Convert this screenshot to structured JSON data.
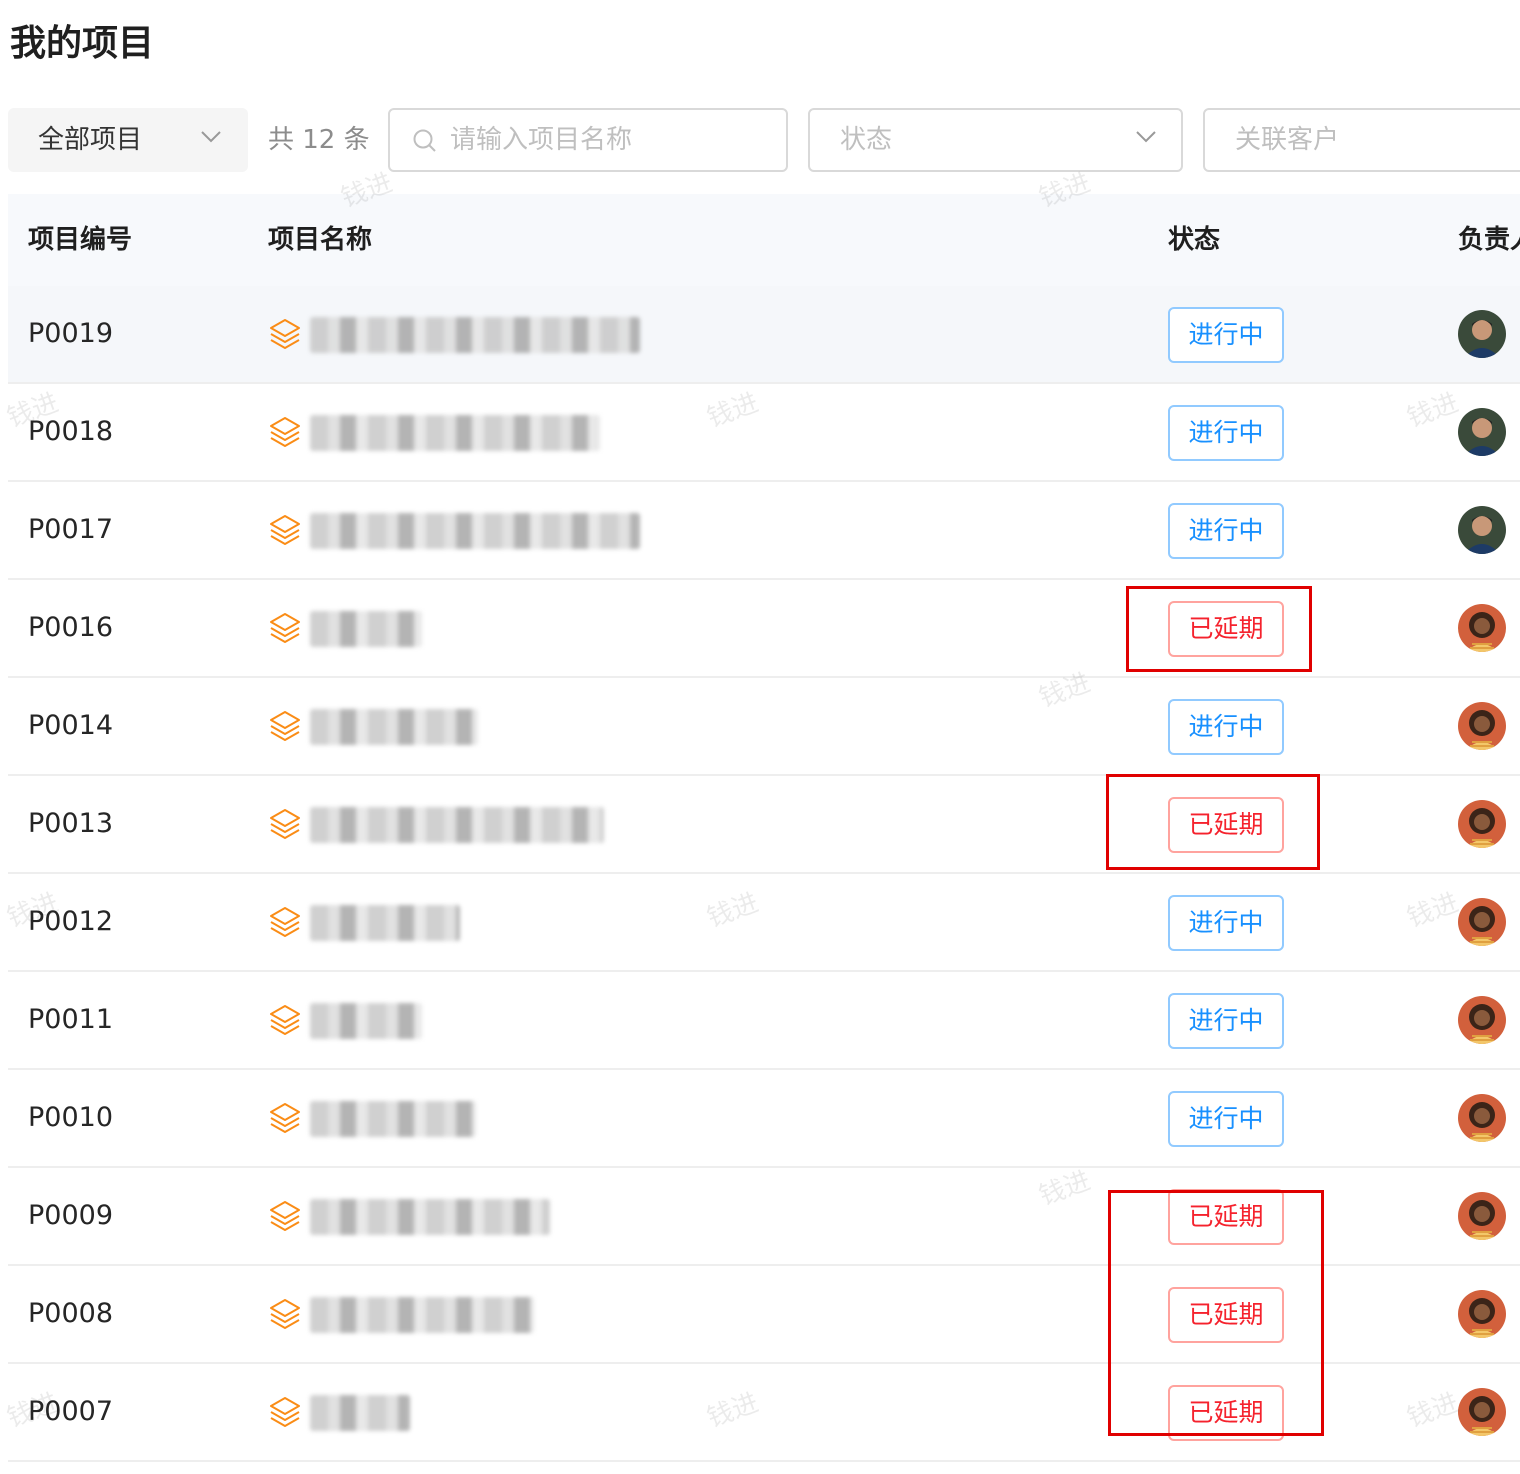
{
  "page": {
    "title": "我的项目"
  },
  "filters": {
    "scope_label": "全部项目",
    "count_text": "共 12 条",
    "search_placeholder": "请输入项目名称",
    "status_placeholder": "状态",
    "client_placeholder": "关联客户"
  },
  "table": {
    "columns": [
      "项目编号",
      "项目名称",
      "状态",
      "负责人"
    ],
    "rows": [
      {
        "code": "P0019",
        "status": "进行中"
      },
      {
        "code": "P0018",
        "status": "进行中"
      },
      {
        "code": "P0017",
        "status": "进行中"
      },
      {
        "code": "P0016",
        "status": "已延期"
      },
      {
        "code": "P0014",
        "status": "进行中"
      },
      {
        "code": "P0013",
        "status": "已延期"
      },
      {
        "code": "P0012",
        "status": "进行中"
      },
      {
        "code": "P0011",
        "status": "进行中"
      },
      {
        "code": "P0010",
        "status": "进行中"
      },
      {
        "code": "P0009",
        "status": "已延期"
      },
      {
        "code": "P0008",
        "status": "已延期"
      },
      {
        "code": "P0007",
        "status": "已延期"
      }
    ]
  },
  "watermark": "钱进",
  "colors": {
    "in_progress": "#1890ff",
    "delayed": "#f5222d",
    "icon": "#fa8c16",
    "annotation_box": "#e00000"
  }
}
